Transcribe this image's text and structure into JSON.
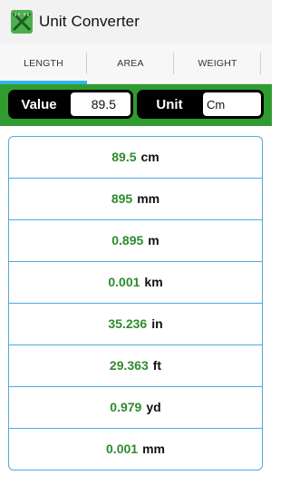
{
  "app": {
    "title": "Unit Converter"
  },
  "tabs": [
    {
      "label": "LENGTH",
      "active": true
    },
    {
      "label": "AREA",
      "active": false
    },
    {
      "label": "WEIGHT",
      "active": false
    }
  ],
  "input": {
    "value_label": "Value",
    "value": "89.5",
    "unit_label": "Unit",
    "unit": "Cm"
  },
  "results": [
    {
      "value": "89.5",
      "unit": "cm"
    },
    {
      "value": "895",
      "unit": "mm"
    },
    {
      "value": "0.895",
      "unit": "m"
    },
    {
      "value": "0.001",
      "unit": "km"
    },
    {
      "value": "35.236",
      "unit": "in"
    },
    {
      "value": "29.363",
      "unit": "ft"
    },
    {
      "value": "0.979",
      "unit": "yd"
    },
    {
      "value": "0.001",
      "unit": "mm"
    }
  ],
  "colors": {
    "accent_green": "#2f9c2f",
    "result_value": "#2e8b2e",
    "tab_indicator": "#33b5e5",
    "list_border": "#4ea9e0"
  },
  "icons": {
    "app_icon": "ruler-app-icon"
  }
}
